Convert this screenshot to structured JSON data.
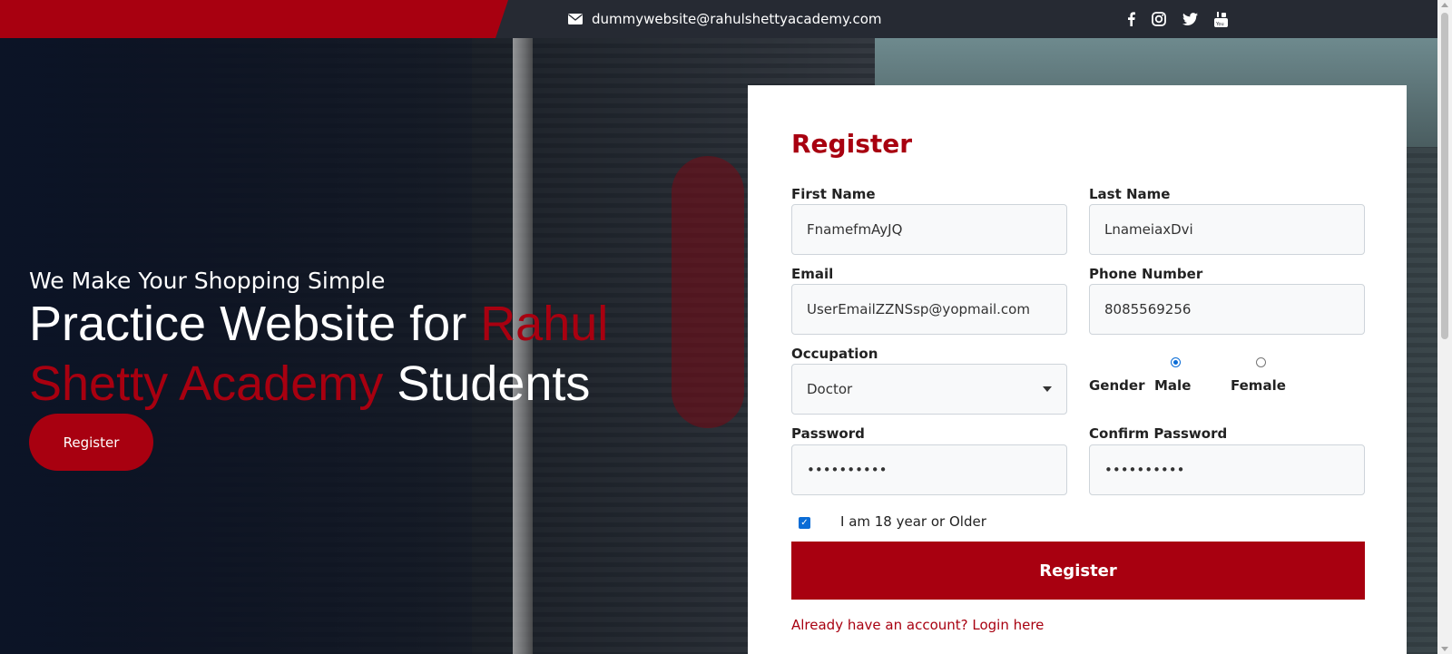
{
  "topbar": {
    "email": "dummywebsite@rahulshettyacademy.com",
    "social_icons": [
      "facebook-icon",
      "instagram-icon",
      "twitter-icon",
      "youtube-icon"
    ]
  },
  "hero": {
    "subtitle": "We Make Your Shopping Simple",
    "title_part1": "Practice Website for ",
    "title_red": "Rahul Shetty Academy",
    "title_part2": " Students",
    "button": "Register"
  },
  "form": {
    "heading": "Register",
    "first_name": {
      "label": "First Name",
      "value": "FnamefmAyJQ"
    },
    "last_name": {
      "label": "Last Name",
      "value": "LnameiaxDvi"
    },
    "email": {
      "label": "Email",
      "value": "UserEmailZZNSsp@yopmail.com"
    },
    "phone": {
      "label": "Phone Number",
      "value": "8085569256"
    },
    "occupation": {
      "label": "Occupation",
      "value": "Doctor"
    },
    "gender": {
      "label": "Gender",
      "options": [
        "Male",
        "Female"
      ],
      "selected": "Male"
    },
    "password": {
      "label": "Password",
      "value": "••••••••••"
    },
    "confirm_password": {
      "label": "Confirm Password",
      "value": "••••••••••"
    },
    "age_check": {
      "label": "I am 18 year or Older",
      "checked": true
    },
    "submit": "Register",
    "login_link": "Already have an account? Login here"
  },
  "colors": {
    "brand_red": "#a80010",
    "topbar": "#262a33",
    "accent_blue": "#0a6cd6"
  }
}
